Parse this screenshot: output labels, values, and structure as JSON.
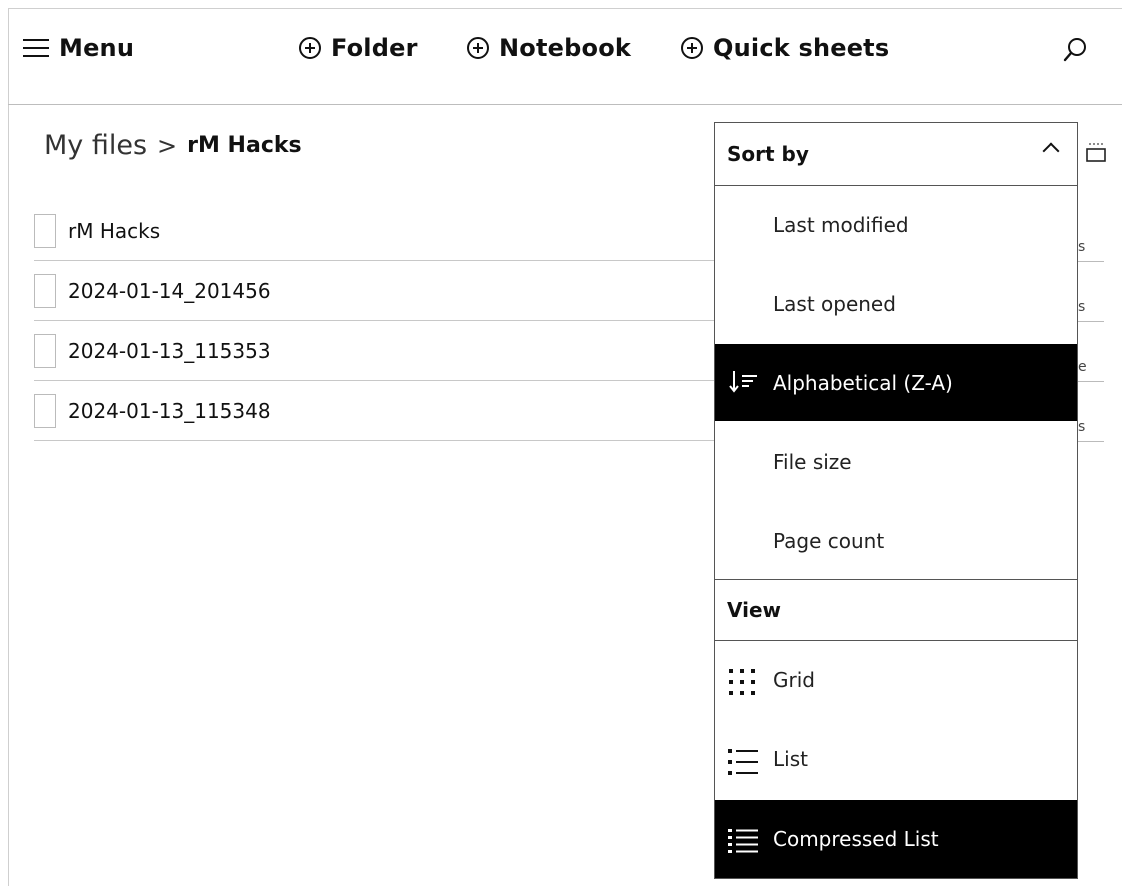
{
  "toolbar": {
    "menu_label": "Menu",
    "folder_label": "Folder",
    "notebook_label": "Notebook",
    "quick_sheets_label": "Quick sheets"
  },
  "breadcrumb": {
    "root": "My files",
    "separator": ">",
    "current": "rM Hacks"
  },
  "files": [
    {
      "name": "rM Hacks"
    },
    {
      "name": "2024-01-14_201456"
    },
    {
      "name": "2024-01-13_115353"
    },
    {
      "name": "2024-01-13_115348"
    }
  ],
  "edge_column": [
    "s",
    "s",
    "e",
    "s"
  ],
  "sort_menu": {
    "header": "Sort by",
    "options": [
      {
        "label": "Last modified",
        "selected": false
      },
      {
        "label": "Last opened",
        "selected": false
      },
      {
        "label": "Alphabetical (Z-A)",
        "selected": true
      },
      {
        "label": "File size",
        "selected": false
      },
      {
        "label": "Page count",
        "selected": false
      }
    ]
  },
  "view_menu": {
    "header": "View",
    "options": [
      {
        "label": "Grid",
        "icon": "grid-icon",
        "selected": false
      },
      {
        "label": "List",
        "icon": "list-icon",
        "selected": false
      },
      {
        "label": "Compressed List",
        "icon": "compressed-list-icon",
        "selected": true
      }
    ]
  },
  "colors": {
    "selected_bg": "#000000",
    "selected_fg": "#ffffff",
    "divider": "#c8c8c8"
  }
}
